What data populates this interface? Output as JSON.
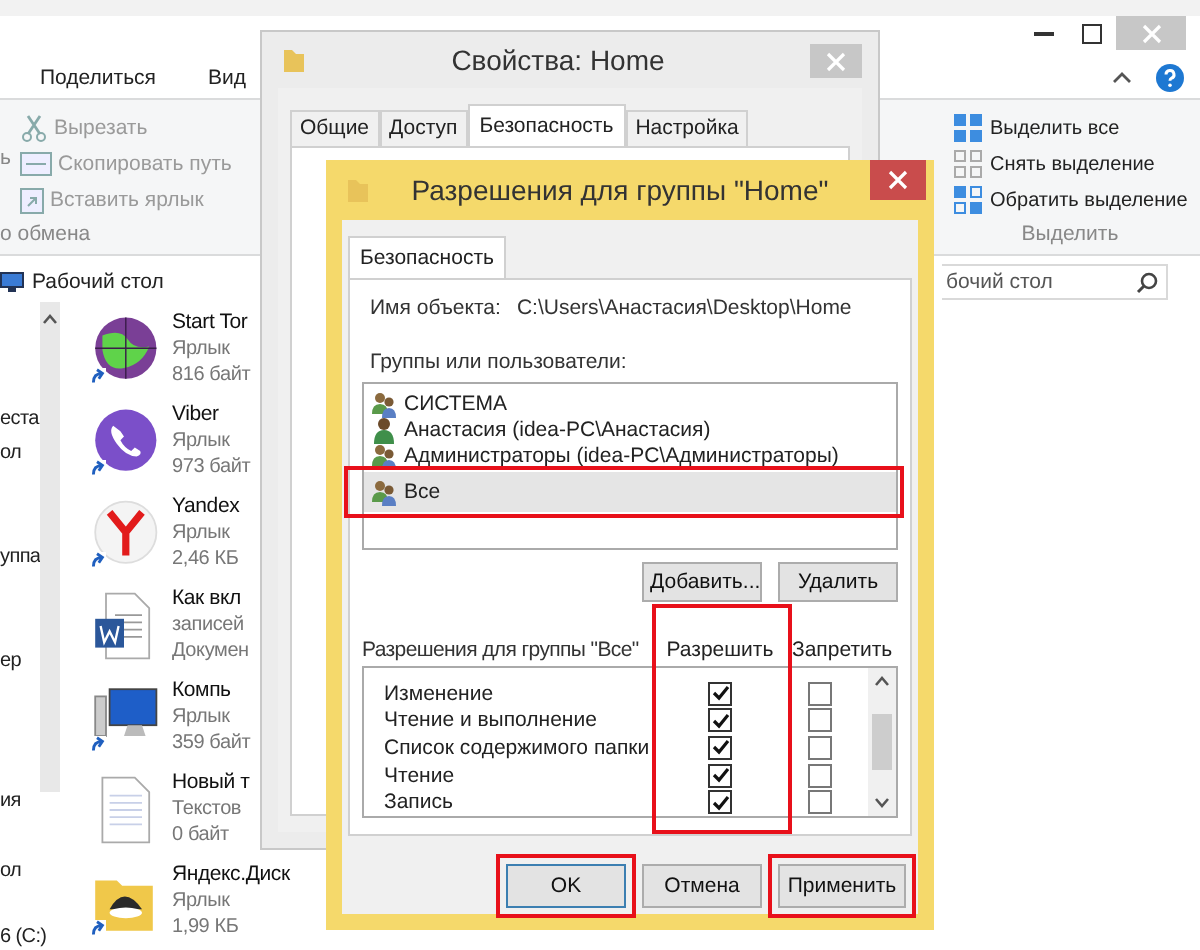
{
  "explorer": {
    "ribbon_tabs": [
      {
        "label": "Поделиться",
        "selected": false
      },
      {
        "label": "Вид",
        "selected": false
      }
    ],
    "clipboard_group": {
      "cut_label": "ь",
      "items": [
        {
          "label": "Вырезать",
          "kind": "cut",
          "disabled": true
        },
        {
          "label": "Скопировать путь",
          "kind": "path",
          "disabled": true
        },
        {
          "label": "Вставить ярлык",
          "kind": "paste",
          "disabled": true
        }
      ],
      "label": "о обмена"
    },
    "select_group": {
      "items": [
        {
          "label": "Выделить все",
          "kind": "all"
        },
        {
          "label": "Снять выделение",
          "kind": "none"
        },
        {
          "label": "Обратить выделение",
          "kind": "invert"
        }
      ],
      "label": "Выделить"
    },
    "address": "Рабочий стол",
    "search": {
      "value": "бочий стол"
    },
    "nav_items": [
      "еста",
      "ол",
      "уппа",
      "ер",
      "ия",
      "ол",
      "6 (C:)"
    ],
    "files": [
      {
        "name": "Start Tor",
        "type": "Ярлык",
        "size": "816 байт",
        "kind": "globe",
        "shortcut": true
      },
      {
        "name": "Viber",
        "type": "Ярлык",
        "size": "973 байт",
        "kind": "phone",
        "shortcut": true
      },
      {
        "name": "Yandex",
        "type": "Ярлык",
        "size": "2,46 КБ",
        "kind": "browser",
        "shortcut": true
      },
      {
        "name": "Как вкл",
        "type": "записей",
        "size": "Докумен",
        "kind": "word",
        "shortcut": false
      },
      {
        "name": "Компь",
        "type": "Ярлык",
        "size": "359 байт",
        "kind": "computer",
        "shortcut": true
      },
      {
        "name": "Новый т",
        "type": "Текстов",
        "size": "0 байт",
        "kind": "text",
        "shortcut": false
      },
      {
        "name": "Яндекс.Диск",
        "type": "Ярлык",
        "size": "1,99 КБ",
        "kind": "disk",
        "shortcut": true
      }
    ]
  },
  "properties": {
    "title": "Свойства: Home",
    "tabs": [
      {
        "label": "Общие",
        "selected": false
      },
      {
        "label": "Доступ",
        "selected": false
      },
      {
        "label": "Безопасность",
        "selected": true
      },
      {
        "label": "Настройка",
        "selected": false
      }
    ]
  },
  "permissions": {
    "title": "Разрешения для группы \"Home\"",
    "tab": "Безопасность",
    "object_label": "Имя объекта:",
    "object_path": "C:\\Users\\Анастасия\\Desktop\\Home",
    "groups_label": "Группы или пользователи:",
    "groups": [
      {
        "name": "СИСТЕМА",
        "kind": "group",
        "selected": false
      },
      {
        "name": "Анастасия (idea-PC\\Анастасия)",
        "kind": "user",
        "selected": false
      },
      {
        "name": "Администраторы (idea-PC\\Администраторы)",
        "kind": "group",
        "selected": false
      },
      {
        "name": "Все",
        "kind": "group",
        "selected": true
      }
    ],
    "add_button": "Добавить...",
    "remove_button": "Удалить",
    "perm_label": "Разрешения для группы \"Все\"",
    "allow_header": "Разрешить",
    "deny_header": "Запретить",
    "rows": [
      {
        "name": "Изменение",
        "allow": true,
        "deny": false
      },
      {
        "name": "Чтение и выполнение",
        "allow": true,
        "deny": false
      },
      {
        "name": "Список содержимого папки",
        "allow": true,
        "deny": false
      },
      {
        "name": "Чтение",
        "allow": true,
        "deny": false
      },
      {
        "name": "Запись",
        "allow": true,
        "deny": false
      }
    ],
    "buttons": [
      "OK",
      "Отмена",
      "Применить"
    ]
  }
}
